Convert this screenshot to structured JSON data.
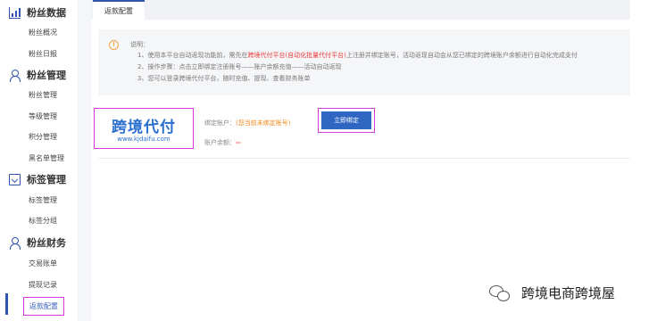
{
  "sidebar": {
    "groups": [
      {
        "title": "粉丝数据",
        "icon": "chart-icon",
        "items": [
          "粉丝概况",
          "粉丝日报"
        ]
      },
      {
        "title": "粉丝管理",
        "icon": "user-icon",
        "items": [
          "粉丝管理",
          "等级管理",
          "积分管理",
          "黑名单管理"
        ]
      },
      {
        "title": "标签管理",
        "icon": "tag-icon",
        "items": [
          "标签管理",
          "标签分组"
        ]
      },
      {
        "title": "粉丝财务",
        "icon": "user-icon",
        "items": [
          "交易账单",
          "提现记录",
          "返款配置"
        ]
      }
    ],
    "active_item": "返款配置"
  },
  "tabs": [
    {
      "label": "返款配置",
      "active": true
    }
  ],
  "notice": {
    "title": "说明：",
    "line1_pre": "1、使用本平台自动返现功能前，需先在",
    "line1_highlight": "跨境代付平台(自动化批量代付平台)",
    "line1_post": "上注册并绑定账号，活动返现自动会从您已绑定的跨境账户余额进行自动化完成支付",
    "line2": "2、操作步骤：点击立即绑定注册账号——账户余额充值——活动自动返现",
    "line3": "3、您可以登录跨境代付平台，随时充值、提现、查看财务账单"
  },
  "account": {
    "logo_text": "跨境代付",
    "logo_url": "www.kjdaifu.com",
    "bind_label": "绑定账户：",
    "bind_value": "(您当前未绑定账号)",
    "balance_label": "账户余额：",
    "balance_value": "--",
    "bind_button": "立即绑定"
  },
  "watermark": {
    "text": "跨境电商跨境屋",
    "icon": "wechat-icon"
  },
  "colors": {
    "accent": "#2f55b0",
    "highlight": "#d63ad9",
    "warning": "#f3a43b",
    "danger": "#e83a3a"
  }
}
